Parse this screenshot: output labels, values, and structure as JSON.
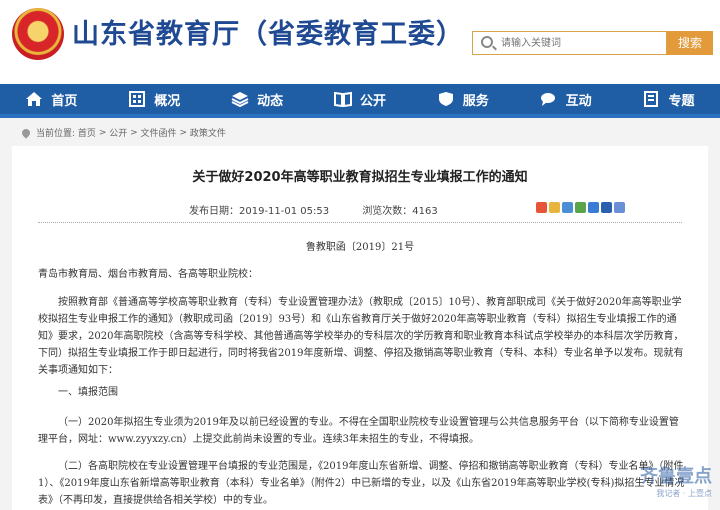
{
  "header": {
    "site_title": "山东省教育厅（省委教育工委）",
    "search_placeholder": "请输入关键词",
    "search_button": "搜索"
  },
  "nav": {
    "items": [
      {
        "label": "首页",
        "icon": "home-icon"
      },
      {
        "label": "概况",
        "icon": "building-icon"
      },
      {
        "label": "动态",
        "icon": "layers-icon"
      },
      {
        "label": "公开",
        "icon": "book-icon"
      },
      {
        "label": "服务",
        "icon": "shield-icon"
      },
      {
        "label": "互动",
        "icon": "chat-icon"
      },
      {
        "label": "专题",
        "icon": "document-icon"
      }
    ]
  },
  "breadcrumb": {
    "items": [
      "当前位置:",
      "首页",
      ">",
      "公开",
      ">",
      "文件函件",
      ">",
      "政策文件"
    ]
  },
  "article": {
    "title": "关于做好2020年高等职业教育拟招生专业填报工作的通知",
    "publish_label": "发布日期：2019-11-01 05:53",
    "views_label": "浏览次数：4163",
    "doc_number": "鲁教职函〔2019〕21号",
    "address": "青岛市教育局、烟台市教育局、各高等职业院校：",
    "para1": "按照教育部《普通高等学校高等职业教育（专科）专业设置管理办法》（教职成〔2015〕10号）、教育部职成司《关于做好2020年高等职业学校拟招生专业申报工作的通知》（教职成司函〔2019〕93号）和《山东省教育厅关于做好2020年高等职业教育（专科）拟招生专业填报工作的通知》要求，2020年高职院校（含高等专科学校、其他普通高等学校举办的专科层次的学历教育和职业教育本科试点学校举办的本科层次学历教育，下同）拟招生专业填报工作于即日起进行，同时将我省2019年度新增、调整、停招及撤销高等职业教育（专科、本科）专业名单予以发布。现就有关事项通知如下：",
    "section1": "一、填报范围",
    "para2": "（一）2020年拟招生专业须为2019年及以前已经设置的专业。不得在全国职业院校专业设置管理与公共信息服务平台（以下简称专业设置管理平台，网址：www.zyyxzy.cn）上提交此前尚未设置的专业。连续3年未招生的专业，不得填报。",
    "para3": "（二）各高职院校在专业设置管理平台填报的专业范围是，《2019年度山东省新增、调整、停招和撤销高等职业教育（专科）专业名单》（附件1）、《2019年度山东省新增高等职业教育（本科）专业名单》（附件2）中已新增的专业，以及《山东省2019年高等职业学校(专科)拟招生专业情况表》（不再印发，直接提供给各相关学校）中的专业。"
  },
  "watermark": {
    "main": "齐鲁壹点",
    "sub": "我记者 · 上壹点"
  },
  "colors": {
    "brand_blue": "#1f5da4",
    "title_blue": "#1f4a93",
    "search_orange": "#e29a3a"
  }
}
